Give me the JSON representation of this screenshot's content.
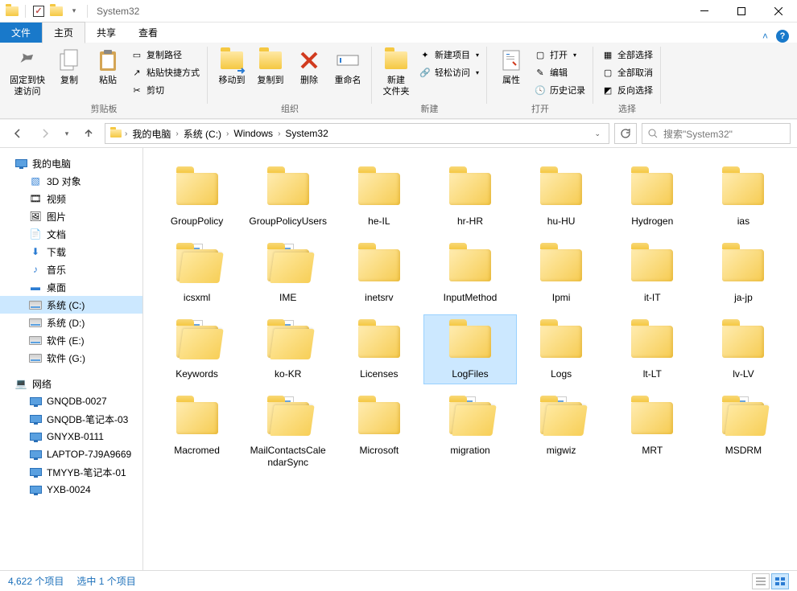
{
  "window": {
    "title": "System32"
  },
  "tabs": {
    "file": "文件",
    "home": "主页",
    "share": "共享",
    "view": "查看"
  },
  "ribbon": {
    "clipboard": {
      "label": "剪贴板",
      "pin": "固定到快\n速访问",
      "copy": "复制",
      "paste": "粘贴",
      "copypath": "复制路径",
      "pasteshortcut": "粘贴快捷方式",
      "cut": "剪切"
    },
    "organize": {
      "label": "组织",
      "moveto": "移动到",
      "copyto": "复制到",
      "delete": "删除",
      "rename": "重命名"
    },
    "new": {
      "label": "新建",
      "newfolder": "新建\n文件夹",
      "newitem": "新建项目",
      "easyaccess": "轻松访问"
    },
    "open": {
      "label": "打开",
      "properties": "属性",
      "open": "打开",
      "edit": "编辑",
      "history": "历史记录"
    },
    "select": {
      "label": "选择",
      "selectall": "全部选择",
      "selectnone": "全部取消",
      "invert": "反向选择"
    }
  },
  "breadcrumb": {
    "pc": "我的电脑",
    "c": "系统 (C:)",
    "win": "Windows",
    "sys": "System32"
  },
  "search": {
    "placeholder": "搜索\"System32\""
  },
  "tree": {
    "pc": "我的电脑",
    "3d": "3D 对象",
    "video": "视频",
    "pictures": "图片",
    "docs": "文档",
    "downloads": "下载",
    "music": "音乐",
    "desktop": "桌面",
    "c": "系统 (C:)",
    "d": "系统 (D:)",
    "e": "软件 (E:)",
    "g": "软件 (G:)",
    "network": "网络",
    "n1": "GNQDB-0027",
    "n2": "GNQDB-笔记本-03",
    "n3": "GNYXB-0111",
    "n4": "LAPTOP-7J9A9669",
    "n5": "TMYYB-笔记本-01",
    "n6": "YXB-0024"
  },
  "items": [
    {
      "n": "GroupPolicy",
      "t": "f"
    },
    {
      "n": "GroupPolicyUsers",
      "t": "f"
    },
    {
      "n": "he-IL",
      "t": "f"
    },
    {
      "n": "hr-HR",
      "t": "f"
    },
    {
      "n": "hu-HU",
      "t": "f"
    },
    {
      "n": "Hydrogen",
      "t": "f"
    },
    {
      "n": "ias",
      "t": "f"
    },
    {
      "n": "icsxml",
      "t": "fo"
    },
    {
      "n": "IME",
      "t": "fo"
    },
    {
      "n": "inetsrv",
      "t": "f"
    },
    {
      "n": "InputMethod",
      "t": "f"
    },
    {
      "n": "Ipmi",
      "t": "f"
    },
    {
      "n": "it-IT",
      "t": "f"
    },
    {
      "n": "ja-jp",
      "t": "f"
    },
    {
      "n": "Keywords",
      "t": "fo"
    },
    {
      "n": "ko-KR",
      "t": "fo"
    },
    {
      "n": "Licenses",
      "t": "f"
    },
    {
      "n": "LogFiles",
      "t": "f",
      "sel": true
    },
    {
      "n": "Logs",
      "t": "f"
    },
    {
      "n": "lt-LT",
      "t": "f"
    },
    {
      "n": "lv-LV",
      "t": "f"
    },
    {
      "n": "Macromed",
      "t": "f"
    },
    {
      "n": "MailContactsCalendarSync",
      "t": "fp"
    },
    {
      "n": "Microsoft",
      "t": "f"
    },
    {
      "n": "migration",
      "t": "fo"
    },
    {
      "n": "migwiz",
      "t": "fo"
    },
    {
      "n": "MRT",
      "t": "f"
    },
    {
      "n": "MSDRM",
      "t": "fp"
    }
  ],
  "status": {
    "count": "4,622 个项目",
    "selected": "选中 1 个项目"
  }
}
